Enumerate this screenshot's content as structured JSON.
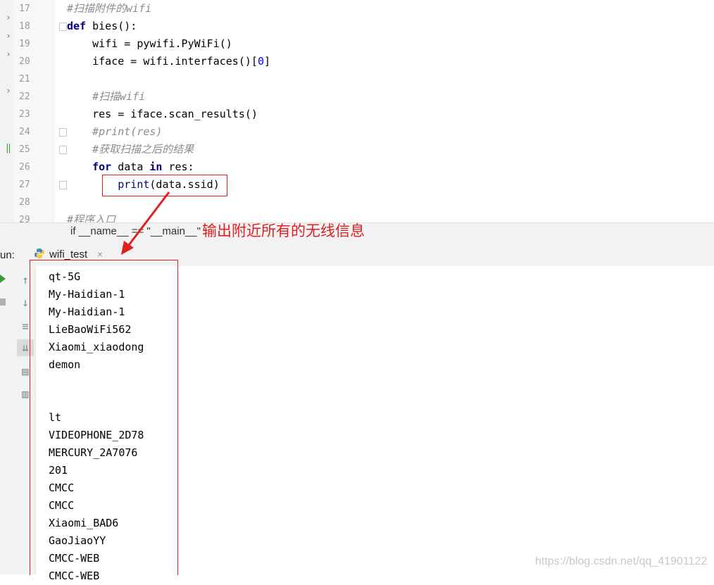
{
  "editor": {
    "line_numbers": [
      "17",
      "18",
      "19",
      "20",
      "21",
      "22",
      "23",
      "24",
      "25",
      "26",
      "27",
      "28",
      "29"
    ],
    "lines": [
      [
        {
          "t": "#扫描附件的wifi",
          "c": "comment"
        }
      ],
      [
        {
          "t": "def ",
          "c": "kw"
        },
        {
          "t": "bies():",
          "c": ""
        }
      ],
      [
        {
          "t": "    wifi = pywifi.PyWiFi()",
          "c": ""
        }
      ],
      [
        {
          "t": "    iface = wifi.interfaces()[",
          "c": ""
        },
        {
          "t": "0",
          "c": "num"
        },
        {
          "t": "]",
          "c": ""
        }
      ],
      [],
      [
        {
          "t": "    ",
          "c": ""
        },
        {
          "t": "#扫描wifi",
          "c": "comment"
        }
      ],
      [
        {
          "t": "    res = iface.scan_results()",
          "c": ""
        }
      ],
      [
        {
          "t": "    ",
          "c": ""
        },
        {
          "t": "#print(res)",
          "c": "comment"
        }
      ],
      [
        {
          "t": "    ",
          "c": ""
        },
        {
          "t": "#获取扫描之后的结果",
          "c": "comment"
        }
      ],
      [
        {
          "t": "    ",
          "c": ""
        },
        {
          "t": "for ",
          "c": "kw"
        },
        {
          "t": "data ",
          "c": ""
        },
        {
          "t": "in ",
          "c": "kw"
        },
        {
          "t": "res:",
          "c": ""
        }
      ],
      [
        {
          "t": "        ",
          "c": ""
        },
        {
          "t": "print",
          "c": "fn"
        },
        {
          "t": "(data.ssid)",
          "c": ""
        }
      ],
      [],
      [
        {
          "t": "#程序入口",
          "c": "comment"
        }
      ]
    ],
    "breadcrumb": "if __name__ == \"__main__\""
  },
  "run_panel": {
    "label": "un:",
    "tab_title": "wifi_test",
    "close_glyph": "×",
    "toolbar_icons": [
      "up-arrow-icon",
      "down-arrow-icon",
      "soft-wrap-icon",
      "scroll-to-end-icon",
      "print-icon",
      "trash-icon"
    ],
    "output_lines": [
      "qt-5G",
      "My-Haidian-1",
      "My-Haidian-1",
      "LieBaoWiFi562",
      "Xiaomi_xiaodong",
      "demon",
      "",
      "",
      "lt",
      "VIDEOPHONE_2D78",
      "MERCURY_2A7076",
      "201",
      "CMCC",
      "CMCC",
      "Xiaomi_BAD6",
      "GaoJiaoYY",
      "CMCC-WEB",
      "CMCC-WEB"
    ]
  },
  "annotation": {
    "text": "输出附近所有的无线信息",
    "color": "#e02020"
  },
  "watermark": "https://blog.csdn.net/qq_41901122",
  "colors": {
    "keyword": "#000080",
    "comment": "#8c8c8c",
    "number": "#0000ff",
    "tab_underline": "#4a86c8"
  }
}
